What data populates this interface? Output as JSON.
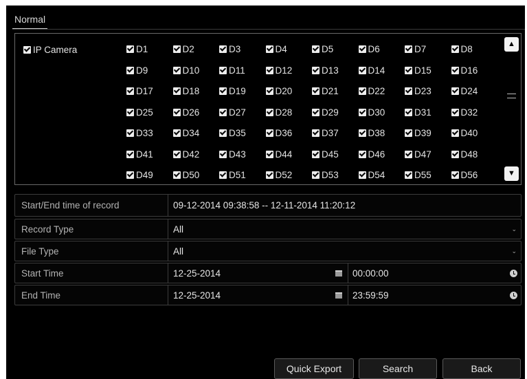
{
  "tab": {
    "label": "Normal"
  },
  "camera_selector": {
    "master_label": "IP Camera",
    "channels": [
      "D1",
      "D2",
      "D3",
      "D4",
      "D5",
      "D6",
      "D7",
      "D8",
      "D9",
      "D10",
      "D11",
      "D12",
      "D13",
      "D14",
      "D15",
      "D16",
      "D17",
      "D18",
      "D19",
      "D20",
      "D21",
      "D22",
      "D23",
      "D24",
      "D25",
      "D26",
      "D27",
      "D28",
      "D29",
      "D30",
      "D31",
      "D32",
      "D33",
      "D34",
      "D35",
      "D36",
      "D37",
      "D38",
      "D39",
      "D40",
      "D41",
      "D42",
      "D43",
      "D44",
      "D45",
      "D46",
      "D47",
      "D48",
      "D49",
      "D50",
      "D51",
      "D52",
      "D53",
      "D54",
      "D55",
      "D56"
    ],
    "all_checked": true
  },
  "conditions": {
    "record_range": {
      "label": "Start/End time of record",
      "value": "09-12-2014 09:38:58 -- 12-11-2014 11:20:12"
    },
    "record_type": {
      "label": "Record Type",
      "value": "All"
    },
    "file_type": {
      "label": "File Type",
      "value": "All"
    },
    "start_time": {
      "label": "Start Time",
      "date": "12-25-2014",
      "time": "00:00:00"
    },
    "end_time": {
      "label": "End Time",
      "date": "12-25-2014",
      "time": "23:59:59"
    }
  },
  "buttons": {
    "quick_export": "Quick Export",
    "search": "Search",
    "back": "Back"
  },
  "colors": {
    "background": "#000000",
    "text": "#e6e6e6",
    "label": "#b3b3b3",
    "border": "#3d3d3d"
  }
}
